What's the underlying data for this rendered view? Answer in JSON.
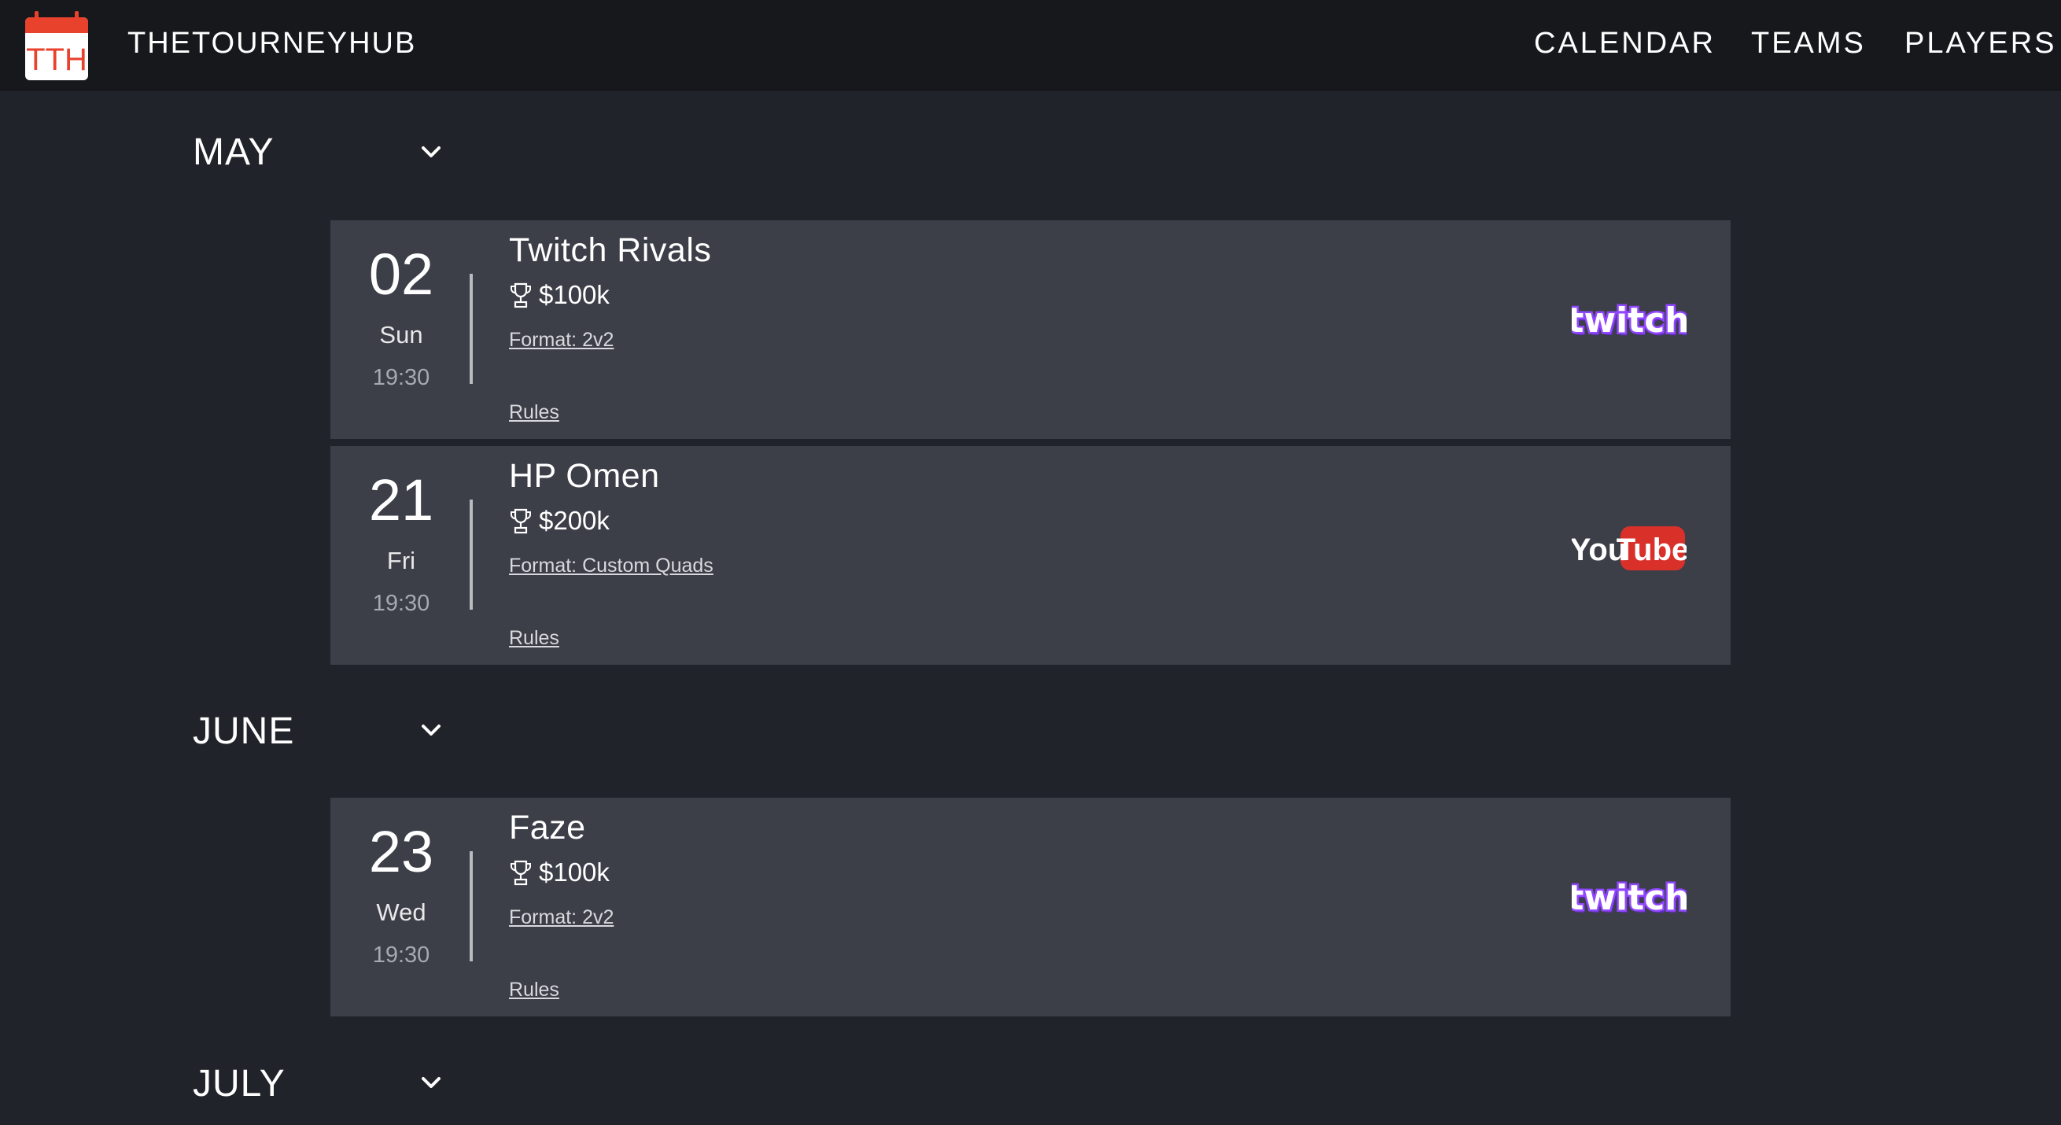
{
  "header": {
    "logo_text": "TTH",
    "brand": "THETOURNEYHUB",
    "nav": [
      {
        "label": "CALENDAR"
      },
      {
        "label": "TEAMS"
      },
      {
        "label": "PLAYERS"
      }
    ]
  },
  "colors": {
    "background": "#21232a",
    "topbar": "#17181c",
    "card": "#3c3e48",
    "logo_red": "#e8412c",
    "twitch_purple": "#9146ff",
    "youtube_red": "#d9302a"
  },
  "months": [
    {
      "name": "MAY",
      "events": [
        {
          "day_num": "02",
          "weekday": "Sun",
          "time": "19:30",
          "title": "Twitch Rivals",
          "prize": "$100k",
          "format": "Format: 2v2",
          "rules": "Rules",
          "platform": "twitch",
          "platform_text": "twitch"
        },
        {
          "day_num": "21",
          "weekday": "Fri",
          "time": "19:30",
          "title": "HP Omen",
          "prize": "$200k",
          "format": "Format: Custom Quads",
          "rules": "Rules",
          "platform": "youtube",
          "platform_text": "YouTube"
        }
      ]
    },
    {
      "name": "JUNE",
      "events": [
        {
          "day_num": "23",
          "weekday": "Wed",
          "time": "19:30",
          "title": "Faze",
          "prize": "$100k",
          "format": "Format: 2v2",
          "rules": "Rules",
          "platform": "twitch",
          "platform_text": "twitch"
        }
      ]
    },
    {
      "name": "JULY",
      "events": []
    }
  ]
}
